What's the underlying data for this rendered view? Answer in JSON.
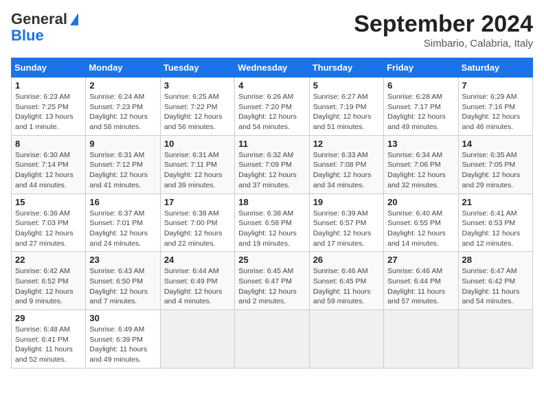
{
  "header": {
    "logo_line1": "General",
    "logo_line2": "Blue",
    "month": "September 2024",
    "location": "Simbario, Calabria, Italy"
  },
  "weekdays": [
    "Sunday",
    "Monday",
    "Tuesday",
    "Wednesday",
    "Thursday",
    "Friday",
    "Saturday"
  ],
  "weeks": [
    [
      {
        "day": "1",
        "info": "Sunrise: 6:23 AM\nSunset: 7:25 PM\nDaylight: 13 hours\nand 1 minute."
      },
      {
        "day": "2",
        "info": "Sunrise: 6:24 AM\nSunset: 7:23 PM\nDaylight: 12 hours\nand 58 minutes."
      },
      {
        "day": "3",
        "info": "Sunrise: 6:25 AM\nSunset: 7:22 PM\nDaylight: 12 hours\nand 56 minutes."
      },
      {
        "day": "4",
        "info": "Sunrise: 6:26 AM\nSunset: 7:20 PM\nDaylight: 12 hours\nand 54 minutes."
      },
      {
        "day": "5",
        "info": "Sunrise: 6:27 AM\nSunset: 7:19 PM\nDaylight: 12 hours\nand 51 minutes."
      },
      {
        "day": "6",
        "info": "Sunrise: 6:28 AM\nSunset: 7:17 PM\nDaylight: 12 hours\nand 49 minutes."
      },
      {
        "day": "7",
        "info": "Sunrise: 6:29 AM\nSunset: 7:16 PM\nDaylight: 12 hours\nand 46 minutes."
      }
    ],
    [
      {
        "day": "8",
        "info": "Sunrise: 6:30 AM\nSunset: 7:14 PM\nDaylight: 12 hours\nand 44 minutes."
      },
      {
        "day": "9",
        "info": "Sunrise: 6:31 AM\nSunset: 7:12 PM\nDaylight: 12 hours\nand 41 minutes."
      },
      {
        "day": "10",
        "info": "Sunrise: 6:31 AM\nSunset: 7:11 PM\nDaylight: 12 hours\nand 39 minutes."
      },
      {
        "day": "11",
        "info": "Sunrise: 6:32 AM\nSunset: 7:09 PM\nDaylight: 12 hours\nand 37 minutes."
      },
      {
        "day": "12",
        "info": "Sunrise: 6:33 AM\nSunset: 7:08 PM\nDaylight: 12 hours\nand 34 minutes."
      },
      {
        "day": "13",
        "info": "Sunrise: 6:34 AM\nSunset: 7:06 PM\nDaylight: 12 hours\nand 32 minutes."
      },
      {
        "day": "14",
        "info": "Sunrise: 6:35 AM\nSunset: 7:05 PM\nDaylight: 12 hours\nand 29 minutes."
      }
    ],
    [
      {
        "day": "15",
        "info": "Sunrise: 6:36 AM\nSunset: 7:03 PM\nDaylight: 12 hours\nand 27 minutes."
      },
      {
        "day": "16",
        "info": "Sunrise: 6:37 AM\nSunset: 7:01 PM\nDaylight: 12 hours\nand 24 minutes."
      },
      {
        "day": "17",
        "info": "Sunrise: 6:38 AM\nSunset: 7:00 PM\nDaylight: 12 hours\nand 22 minutes."
      },
      {
        "day": "18",
        "info": "Sunrise: 6:38 AM\nSunset: 6:58 PM\nDaylight: 12 hours\nand 19 minutes."
      },
      {
        "day": "19",
        "info": "Sunrise: 6:39 AM\nSunset: 6:57 PM\nDaylight: 12 hours\nand 17 minutes."
      },
      {
        "day": "20",
        "info": "Sunrise: 6:40 AM\nSunset: 6:55 PM\nDaylight: 12 hours\nand 14 minutes."
      },
      {
        "day": "21",
        "info": "Sunrise: 6:41 AM\nSunset: 6:53 PM\nDaylight: 12 hours\nand 12 minutes."
      }
    ],
    [
      {
        "day": "22",
        "info": "Sunrise: 6:42 AM\nSunset: 6:52 PM\nDaylight: 12 hours\nand 9 minutes."
      },
      {
        "day": "23",
        "info": "Sunrise: 6:43 AM\nSunset: 6:50 PM\nDaylight: 12 hours\nand 7 minutes."
      },
      {
        "day": "24",
        "info": "Sunrise: 6:44 AM\nSunset: 6:49 PM\nDaylight: 12 hours\nand 4 minutes."
      },
      {
        "day": "25",
        "info": "Sunrise: 6:45 AM\nSunset: 6:47 PM\nDaylight: 12 hours\nand 2 minutes."
      },
      {
        "day": "26",
        "info": "Sunrise: 6:46 AM\nSunset: 6:45 PM\nDaylight: 11 hours\nand 59 minutes."
      },
      {
        "day": "27",
        "info": "Sunrise: 6:46 AM\nSunset: 6:44 PM\nDaylight: 11 hours\nand 57 minutes."
      },
      {
        "day": "28",
        "info": "Sunrise: 6:47 AM\nSunset: 6:42 PM\nDaylight: 11 hours\nand 54 minutes."
      }
    ],
    [
      {
        "day": "29",
        "info": "Sunrise: 6:48 AM\nSunset: 6:41 PM\nDaylight: 11 hours\nand 52 minutes."
      },
      {
        "day": "30",
        "info": "Sunrise: 6:49 AM\nSunset: 6:39 PM\nDaylight: 11 hours\nand 49 minutes."
      },
      null,
      null,
      null,
      null,
      null
    ]
  ]
}
